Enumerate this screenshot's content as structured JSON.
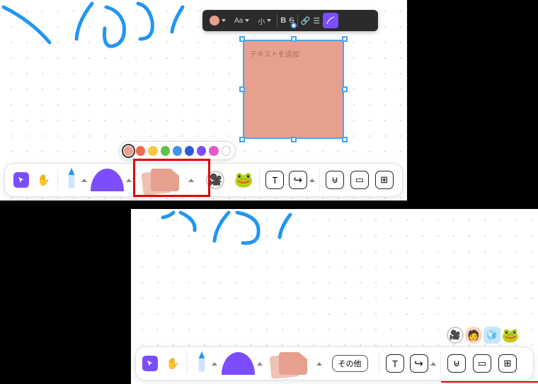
{
  "dark_toolbar": {
    "font_label": "Aa",
    "size_label": "小",
    "bold": "B",
    "strike": "S"
  },
  "sticky": {
    "placeholder": "テキストを追加"
  },
  "color_palette": {
    "colors": [
      "#e8a08e",
      "#f36a4a",
      "#f7c948",
      "#5bc24c",
      "#3e97e8",
      "#2c5bd6",
      "#7c4dff",
      "#e659c8",
      "#ffffff"
    ]
  },
  "toolbar": {
    "text_tool": "T",
    "other_label": "その他"
  }
}
